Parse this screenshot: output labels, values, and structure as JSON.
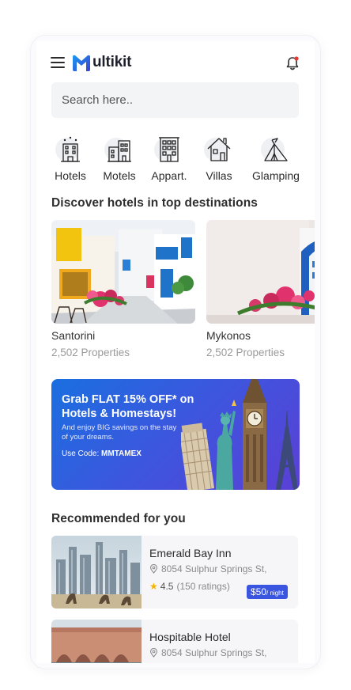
{
  "header": {
    "logo_text": "ultikit",
    "logo_letter": "M"
  },
  "search": {
    "placeholder": "Search here.."
  },
  "categories": [
    {
      "label": "Hotels",
      "icon": "hotel-building-icon"
    },
    {
      "label": "Motels",
      "icon": "motel-building-icon"
    },
    {
      "label": "Appart.",
      "icon": "apartment-building-icon"
    },
    {
      "label": "Villas",
      "icon": "villa-house-icon"
    },
    {
      "label": "Glamping",
      "icon": "tent-icon"
    }
  ],
  "destinations": {
    "title": "Discover hotels in top destinations",
    "items": [
      {
        "name": "Santorini",
        "count": "2,502 Properties"
      },
      {
        "name": "Mykonos",
        "count": "2,502 Properties"
      }
    ]
  },
  "promo": {
    "title": "Grab FLAT 15% OFF* on Hotels & Homestays!",
    "subtitle": "And enjoy BIG savings on the stay of your dreams.",
    "code_label": "Use Code:",
    "code": "MMTAMEX"
  },
  "recommended": {
    "title": "Recommended for you",
    "items": [
      {
        "name": "Emerald Bay Inn",
        "address": "8054 Sulphur Springs St,",
        "rating": "4.5",
        "ratings_count": "(150 ratings)",
        "price": "$50",
        "price_unit": "/ night"
      },
      {
        "name": "Hospitable Hotel",
        "address": "8054 Sulphur Springs St,"
      }
    ]
  },
  "colors": {
    "accent": "#3a55e0",
    "promo_start": "#1a6fe0",
    "promo_end": "#5b3fd6",
    "star": "#f5b400",
    "notification_dot": "#e53935"
  }
}
